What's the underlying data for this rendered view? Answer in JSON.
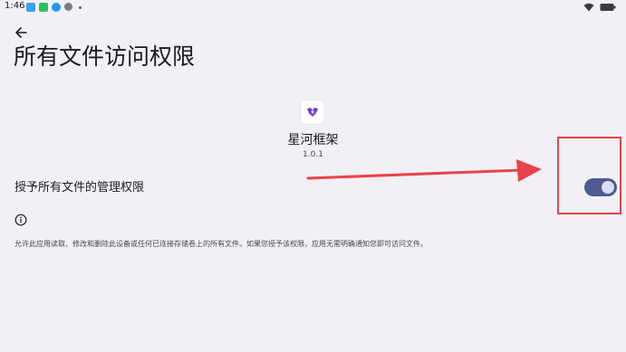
{
  "status_bar": {
    "time": "1:46"
  },
  "header": {
    "title": "所有文件访问权限"
  },
  "app": {
    "name": "星河框架",
    "version": "1.0.1"
  },
  "permission": {
    "label": "授予所有文件的管理权限",
    "enabled": true
  },
  "description": "允许此应用读取、修改和删除此设备或任何已连接存储卷上的所有文件。如果您授予该权限，应用无需明确通知您即可访问文件。",
  "colors": {
    "background": "#f3f0f5",
    "toggle_track": "#4e5b92",
    "toggle_thumb": "#dcdcf7",
    "annotation": "#e8424a"
  },
  "icons": {
    "back": "arrow-left-icon",
    "info": "info-circle-icon",
    "wifi": "wifi-icon",
    "battery": "battery-icon"
  }
}
